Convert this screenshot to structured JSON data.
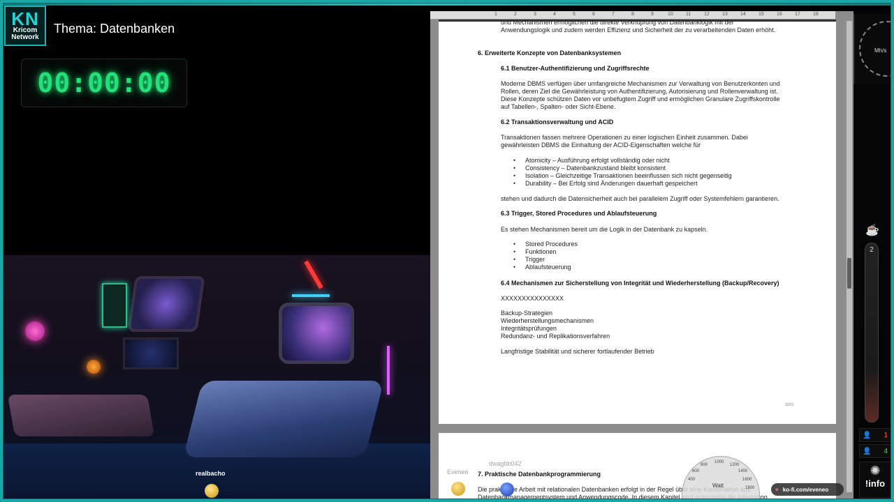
{
  "brand": {
    "short": "KN",
    "name": "Kricom Network"
  },
  "topic": "Thema: Datenbanken",
  "timer": "00:00:00",
  "camera": {
    "username": "realbacho"
  },
  "ruler": [
    "1",
    "2",
    "3",
    "4",
    "5",
    "6",
    "7",
    "8",
    "9",
    "10",
    "11",
    "12",
    "13",
    "14",
    "15",
    "16",
    "17",
    "18"
  ],
  "document": {
    "top_fragment_1": "und Mechanismen ermöglichen die direkte Verknüpfung von Datenbanklogik mit der",
    "top_fragment_2": "Anwendungslogik und zudem werden Effizienz und Sicherheit der zu verarbeitenden Daten erhöht.",
    "h6": "6. Erweiterte Konzepte von Datenbanksystemen",
    "h61": "6.1 Benutzer-Authentifizierung und Zugriffsrechte",
    "p61": [
      "Moderne DBMS verfügen über umfangreiche Mechanismen zur Verwaltung von Benutzerkonten und",
      "Rollen, deren Ziel die Gewährleistung von Authentifizierung, Autorisierung und Rollenverwaltung ist.",
      "Diese Konzepte schützen Daten vor unbefugtem Zugriff und ermöglichen Granulare Zugriffskontrolle",
      "auf Tabellen-, Spalten- oder Sicht-Ebene."
    ],
    "h62": "6.2 Transaktionsverwaltung und ACID",
    "p62": [
      "Transaktionen fassen mehrere Operationen zu einer logischen Einheit zusammen. Dabei",
      "gewährleisten DBMS die Einhaltung der ACID-Eigenschaften welche für"
    ],
    "acid": [
      "Atomicity – Ausführung erfolgt vollständig oder nicht",
      "Consistency – Datenbankzustand bleibt konsistent",
      "Isolation – Gleichzeitige Transaktionen beeinflussen sich nicht gegenseitig",
      "Durability – Bei Erfolg sind Änderungen dauerhaft gespeichert"
    ],
    "p62b": "stehen und dadurch die Datensicherheit auch bei parallelem Zugriff oder Systemfehlern garantieren.",
    "h63": "6.3 Trigger, Stored Procedures und Ablaufsteuerung",
    "p63": "Es stehen Mechanismen bereit um die Logik in der Datenbank zu kapseln.",
    "list63": [
      "Stored Procedures",
      "Funktionen",
      "Trigger",
      "Ablaufsteuerung"
    ],
    "h64": "6.4 Mechanismen zur Sicherstellung von Integrität und Wiederherstellung (Backup/Recovery)",
    "x64": "XXXXXXXXXXXXXXX",
    "lines64": [
      "Backup-Strategien",
      "Wiederherstellungsmechanismen",
      "Integritätsprüfungen",
      "Redundanz- und Replikationsverfahren"
    ],
    "p64": "Langfristige Stabilität und sicherer fortlaufender Betrieb",
    "page_foot": "12/21",
    "h7": "7. Praktische Datenbankprogrammierung",
    "p7": [
      "Die praktische Arbeit mit relationalen Datenbanken erfolgt in der Regel über eine Kombination aus",
      "Datenbankmanagementsystem und Anwendungscode. In diesem Kapitel wird praxisnahe die Integration"
    ]
  },
  "overlays": {
    "ghost_1": "Eveneo",
    "ghost_2": "dwagbb042",
    "watt": "Watt",
    "watt_ticks": [
      "400",
      "600",
      "800",
      "1000",
      "1200",
      "1400",
      "1600",
      "1800"
    ],
    "kofi": "ko-fi.com/eveneo"
  },
  "widgets": {
    "gauge_label": "Mh/s",
    "tube_count": "2",
    "stat1": "1",
    "stat2": "4",
    "info": "!info",
    "colors": {
      "accent": "#1aa7a7",
      "timer": "#22e07a",
      "stat1": "#ff5a5a",
      "stat2": "#3adb5a"
    }
  }
}
